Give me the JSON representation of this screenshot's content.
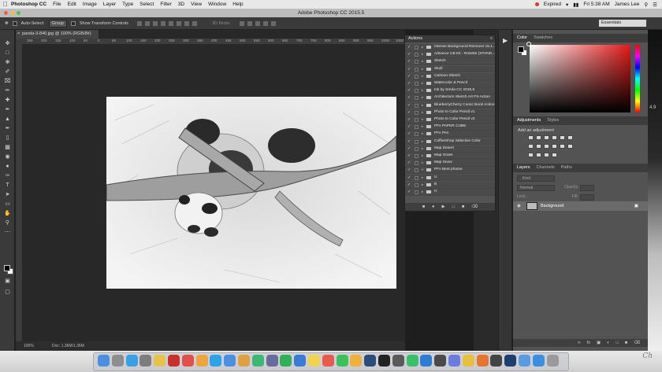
{
  "menubar": {
    "apple_icon": "",
    "app_name": "Photoshop CC",
    "menus": [
      "File",
      "Edit",
      "Image",
      "Layer",
      "Type",
      "Select",
      "Filter",
      "3D",
      "View",
      "Window",
      "Help"
    ],
    "status": "Expired",
    "clock": "Fri 5:38 AM",
    "user": "James Lee"
  },
  "titlebar": {
    "title": "Adobe Photoshop CC 2015.5"
  },
  "optionsbar": {
    "auto_select_label": "Auto-Select:",
    "auto_select_value": "Group",
    "show_transform_label": "Show Transform Controls",
    "mode_3d_label": "3D Mode:",
    "workspace": "Essentials"
  },
  "document": {
    "tab_title": "panda-3-840.jpg @ 100% (RGB/8#)",
    "zoom": "100%",
    "doc_size": "Doc: 1.36M/1.36M",
    "ruler_ticks": [
      "250",
      "200",
      "150",
      "100",
      "50",
      "0",
      "50",
      "100",
      "150",
      "200",
      "250",
      "300",
      "350",
      "400",
      "450",
      "500",
      "550",
      "600",
      "650",
      "700",
      "750",
      "800",
      "850",
      "900",
      "950",
      "1000",
      "1050"
    ]
  },
  "actions_panel": {
    "tab": "Actions",
    "items": [
      {
        "name": "Intense Background Remover v5.1...",
        "checked": true,
        "expanded": false
      },
      {
        "name": "Advance CB Kit - Rosette (STAND...",
        "checked": true,
        "expanded": false
      },
      {
        "name": "Sketch",
        "checked": true,
        "expanded": false
      },
      {
        "name": "Skull",
        "checked": true,
        "expanded": false
      },
      {
        "name": "Cartoon Sketch",
        "checked": true,
        "expanded": false
      },
      {
        "name": "Watercolor & Pencil",
        "checked": true,
        "expanded": false
      },
      {
        "name": "Ink by Sreda CC 2015.5",
        "checked": true,
        "expanded": false
      },
      {
        "name": "Architecture Sketch Art PS Action",
        "checked": true,
        "expanded": false
      },
      {
        "name": "BlueberryCherry Comic Book Action",
        "checked": true,
        "expanded": false
      },
      {
        "name": "Photo to Color Pencil v1",
        "checked": true,
        "expanded": false
      },
      {
        "name": "Photo to Color Pencil v2",
        "checked": true,
        "expanded": false
      },
      {
        "name": "PFx PAPER CUBE",
        "checked": true,
        "expanded": false
      },
      {
        "name": "PFx Pen",
        "checked": true,
        "expanded": false
      },
      {
        "name": "CoffeeShop Selective Color",
        "checked": true,
        "expanded": false
      },
      {
        "name": "Map Desert",
        "checked": true,
        "expanded": false
      },
      {
        "name": "Map Grass",
        "checked": true,
        "expanded": false
      },
      {
        "name": "Map Snow",
        "checked": true,
        "expanded": false
      },
      {
        "name": "PFx Bent photos",
        "checked": true,
        "expanded": true
      },
      {
        "name": "U",
        "checked": true,
        "expanded": false
      },
      {
        "name": "B",
        "checked": true,
        "expanded": false
      },
      {
        "name": "H",
        "checked": true,
        "expanded": false
      }
    ]
  },
  "color_panel": {
    "tabs": [
      "Color",
      "Swatches"
    ],
    "fg_color": "#000000",
    "bg_color": "#ffffff",
    "hue_color": "#e41b1b"
  },
  "adjustments_panel": {
    "tabs": [
      "Adjustments",
      "Styles"
    ],
    "add_label": "Add an adjustment"
  },
  "layers_panel": {
    "tabs": [
      "Layers",
      "Channels",
      "Paths"
    ],
    "kind_label": "Kind",
    "blend_mode": "Normal",
    "opacity_label": "Opacity:",
    "lock_label": "Lock:",
    "fill_label": "Fill:",
    "layers": [
      {
        "name": "Background",
        "locked": true
      }
    ]
  },
  "desktop": {
    "side_numbers": [
      "4.9"
    ]
  },
  "dock": {
    "icons": [
      "finder",
      "launchpad",
      "safari",
      "system-preferences",
      "chrome",
      "filezilla",
      "itunes",
      "photos",
      "skype",
      "chrome-alt",
      "photos-alt",
      "maps",
      "imovie",
      "drive",
      "preview",
      "notes",
      "calendar",
      "messages",
      "google-photos",
      "lightroom",
      "terminal",
      "activity",
      "phone",
      "xcode",
      "camera",
      "discord",
      "chrome-canary",
      "firefox",
      "camera-raw",
      "photoshop",
      "folder",
      "downloads",
      "trash"
    ],
    "colors": {
      "blue": "#2e6fd0",
      "red": "#d63a2b",
      "dark": "#1c2434",
      "gray": "#8a8a8a"
    }
  }
}
